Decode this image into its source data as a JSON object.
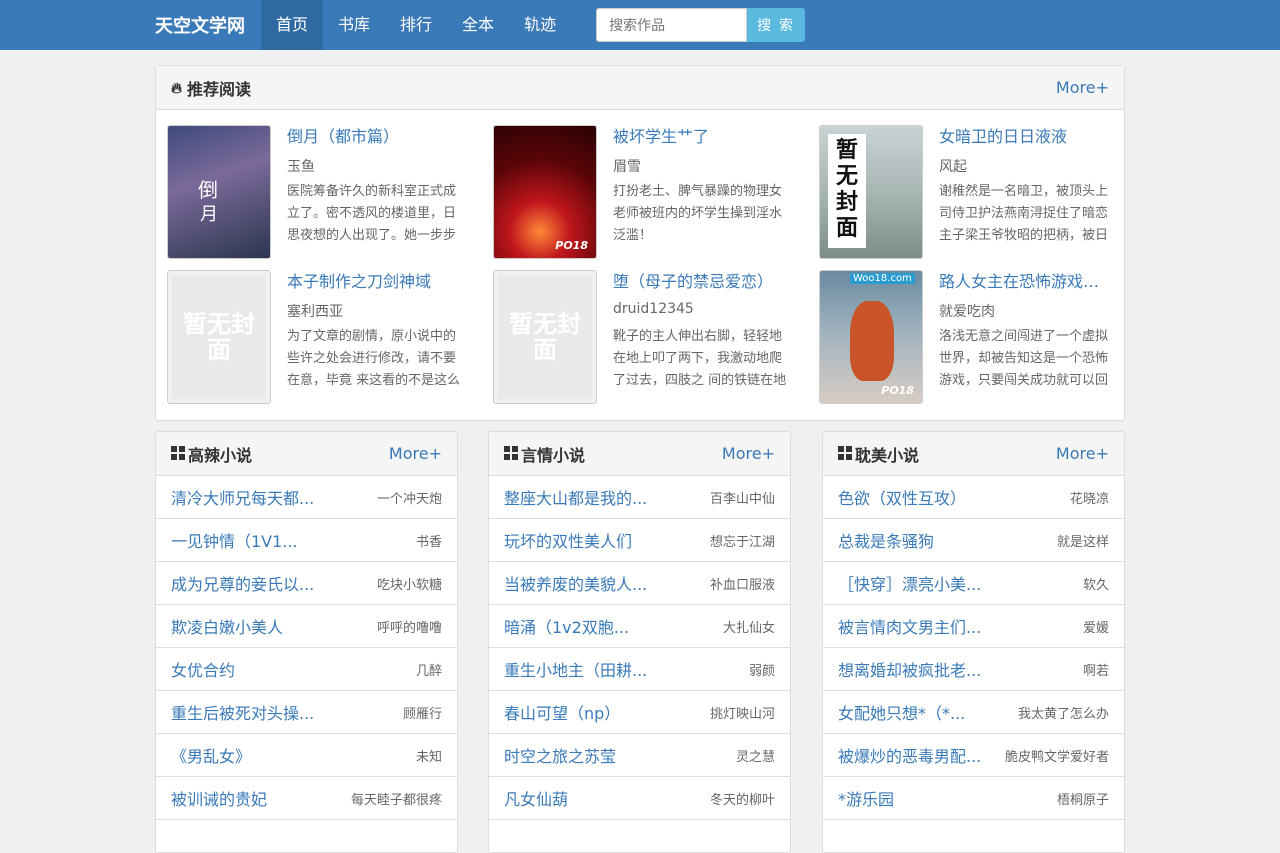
{
  "nav": {
    "brand": "天空文学网",
    "items": [
      {
        "label": "首页",
        "active": true
      },
      {
        "label": "书库",
        "active": false
      },
      {
        "label": "排行",
        "active": false
      },
      {
        "label": "全本",
        "active": false
      },
      {
        "label": "轨迹",
        "active": false
      }
    ],
    "search_placeholder": "搜索作品",
    "search_button": "搜 索"
  },
  "recommend": {
    "title": "推荐阅读",
    "more": "More+",
    "books": [
      {
        "title": "倒月（都市篇）",
        "author": "玉鱼",
        "desc": "医院筹备许久的新科室正式成立了。密不透风的楼道里，日思夜想的人出现了。她一步步",
        "cover_text_1": "倒",
        "cover_text_2": "月"
      },
      {
        "title": "被坏学生艹了",
        "author": "眉雪",
        "desc": "打扮老土、脾气暴躁的物理女老师被班内的坏学生操到淫水泛滥！",
        "cover_badge": "PO18"
      },
      {
        "title": "女暗卫的日日液液",
        "author": "风起",
        "desc": "谢稚然是一名暗卫，被顶头上司侍卫护法燕南浔捉住了暗恋主子梁王爷牧昭的把柄，被日",
        "cover_text": "暂无封面"
      },
      {
        "title": "本子制作之刀剑神域",
        "author": "塞利西亚",
        "desc": "为了文章的剧情，原小说中的些许之处会进行修改，请不要在意，毕竟 来这看的不是这么",
        "cover_text": "暂无封面"
      },
      {
        "title": "堕（母子的禁忌爱恋）",
        "author": "druid12345",
        "desc": "靴子的主人伸出右脚，轻轻地在地上叩了两下，我激动地爬了过去，四肢之 间的铁链在地",
        "cover_text": "暂无封面"
      },
      {
        "title": "路人女主在恐怖游戏…",
        "author": "就爱吃肉",
        "desc": "洛浅无意之间闯进了一个虚拟世界，却被告知这是一个恐怖游戏，只要闯关成功就可以回",
        "cover_badge": "PO18",
        "cover_watermark": "Woo18.com"
      }
    ]
  },
  "lists": [
    {
      "title": "高辣小说",
      "more": "More+",
      "rows": [
        {
          "title": "清冷大师兄每天都...",
          "author": "一个冲天炮"
        },
        {
          "title": "一见钟情（1V1...",
          "author": "书香"
        },
        {
          "title": "成为兄尊的妾氏以...",
          "author": "吃块小软糖"
        },
        {
          "title": "欺凌白嫩小美人",
          "author": "呼呼的噜噜"
        },
        {
          "title": "女优合约",
          "author": "几醉"
        },
        {
          "title": "重生后被死对头操...",
          "author": "顾雁行"
        },
        {
          "title": "《男乱女》",
          "author": "未知"
        },
        {
          "title": "被训诫的贵妃",
          "author": "每天睦子都很疼"
        }
      ]
    },
    {
      "title": "言情小说",
      "more": "More+",
      "rows": [
        {
          "title": "整座大山都是我的...",
          "author": "百李山中仙"
        },
        {
          "title": "玩坏的双性美人们",
          "author": "想忘于江湖"
        },
        {
          "title": "当被养废的美貌人...",
          "author": "补血口服液"
        },
        {
          "title": "暗涌（1v2双胞...",
          "author": "大扎仙女"
        },
        {
          "title": "重生小地主（田耕...",
          "author": "弱颜"
        },
        {
          "title": "春山可望（np）",
          "author": "挑灯映山河"
        },
        {
          "title": "时空之旅之苏莹",
          "author": "灵之慧"
        },
        {
          "title": "凡女仙葫",
          "author": "冬天的柳叶"
        }
      ]
    },
    {
      "title": "耽美小说",
      "more": "More+",
      "rows": [
        {
          "title": "色欲（双性互攻）",
          "author": "花晓凉"
        },
        {
          "title": "总裁是条骚狗",
          "author": "就是这样"
        },
        {
          "title": "［快穿］漂亮小美...",
          "author": "软久"
        },
        {
          "title": "被言情肉文男主们...",
          "author": "爱媛"
        },
        {
          "title": "想离婚却被疯批老...",
          "author": "啊若"
        },
        {
          "title": "女配她只想*（*...",
          "author": "我太黄了怎么办"
        },
        {
          "title": "被爆炒的恶毒男配...",
          "author": "脆皮鸭文学爱好者"
        },
        {
          "title": "*游乐园",
          "author": "梧桐原子"
        }
      ]
    }
  ]
}
